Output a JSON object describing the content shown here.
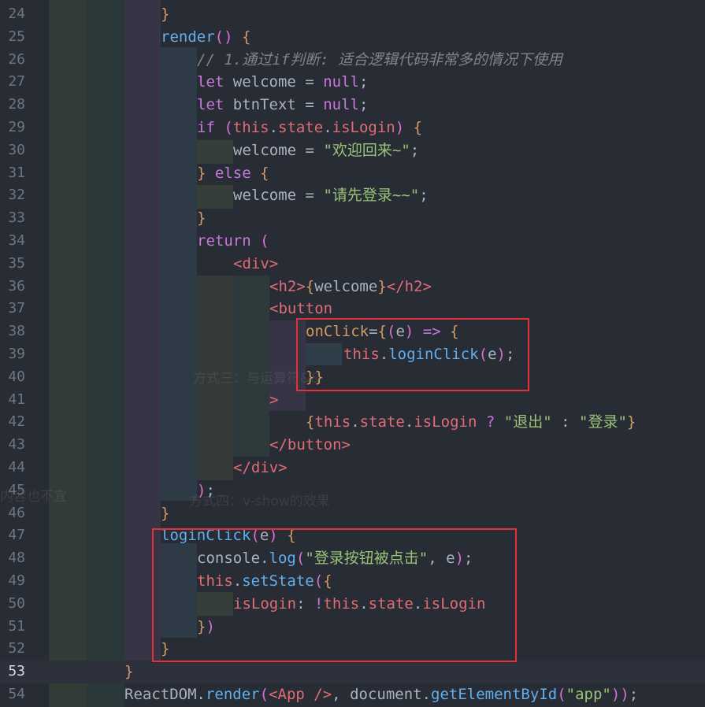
{
  "lines": [
    {
      "n": "24",
      "code": "}"
    },
    {
      "n": "25",
      "code": "render() {"
    },
    {
      "n": "26",
      "code": "// 1.通过if判断: 适合逻辑代码非常多的情况下使用"
    },
    {
      "n": "27",
      "code": "let welcome = null;"
    },
    {
      "n": "28",
      "code": "let btnText = null;"
    },
    {
      "n": "29",
      "code": "if (this.state.isLogin) {"
    },
    {
      "n": "30",
      "code": "welcome = \"欢迎回来~\";"
    },
    {
      "n": "31",
      "code": "} else {"
    },
    {
      "n": "32",
      "code": "welcome = \"请先登录~~\";"
    },
    {
      "n": "33",
      "code": "}"
    },
    {
      "n": "34",
      "code": "return ("
    },
    {
      "n": "35",
      "code": "<div>"
    },
    {
      "n": "36",
      "code": "<h2>{welcome}</h2>"
    },
    {
      "n": "37",
      "code": "<button"
    },
    {
      "n": "38",
      "code": "onClick={(e) => {"
    },
    {
      "n": "39",
      "code": "this.loginClick(e);"
    },
    {
      "n": "40",
      "code": "}}"
    },
    {
      "n": "41",
      "code": ">"
    },
    {
      "n": "42",
      "code": "{this.state.isLogin ? \"退出\" : \"登录\"}"
    },
    {
      "n": "43",
      "code": "</button>"
    },
    {
      "n": "44",
      "code": "</div>"
    },
    {
      "n": "45",
      "code": ");"
    },
    {
      "n": "46",
      "code": "}"
    },
    {
      "n": "47",
      "code": "loginClick(e) {"
    },
    {
      "n": "48",
      "code": "console.log(\"登录按钮被点击\", e);"
    },
    {
      "n": "49",
      "code": "this.setState({"
    },
    {
      "n": "50",
      "code": "isLogin: !this.state.isLogin"
    },
    {
      "n": "51",
      "code": "})"
    },
    {
      "n": "52",
      "code": "}"
    },
    {
      "n": "53",
      "code": "}"
    },
    {
      "n": "54",
      "code": "ReactDOM.render(<App />, document.getElementById(\"app\"));"
    }
  ],
  "current_line": "53",
  "colors": {
    "background": "#282c34",
    "highlight_box": "#e5303a",
    "keyword": "#c678dd",
    "function": "#61afef",
    "string": "#98c379",
    "comment": "#7f848e"
  }
}
